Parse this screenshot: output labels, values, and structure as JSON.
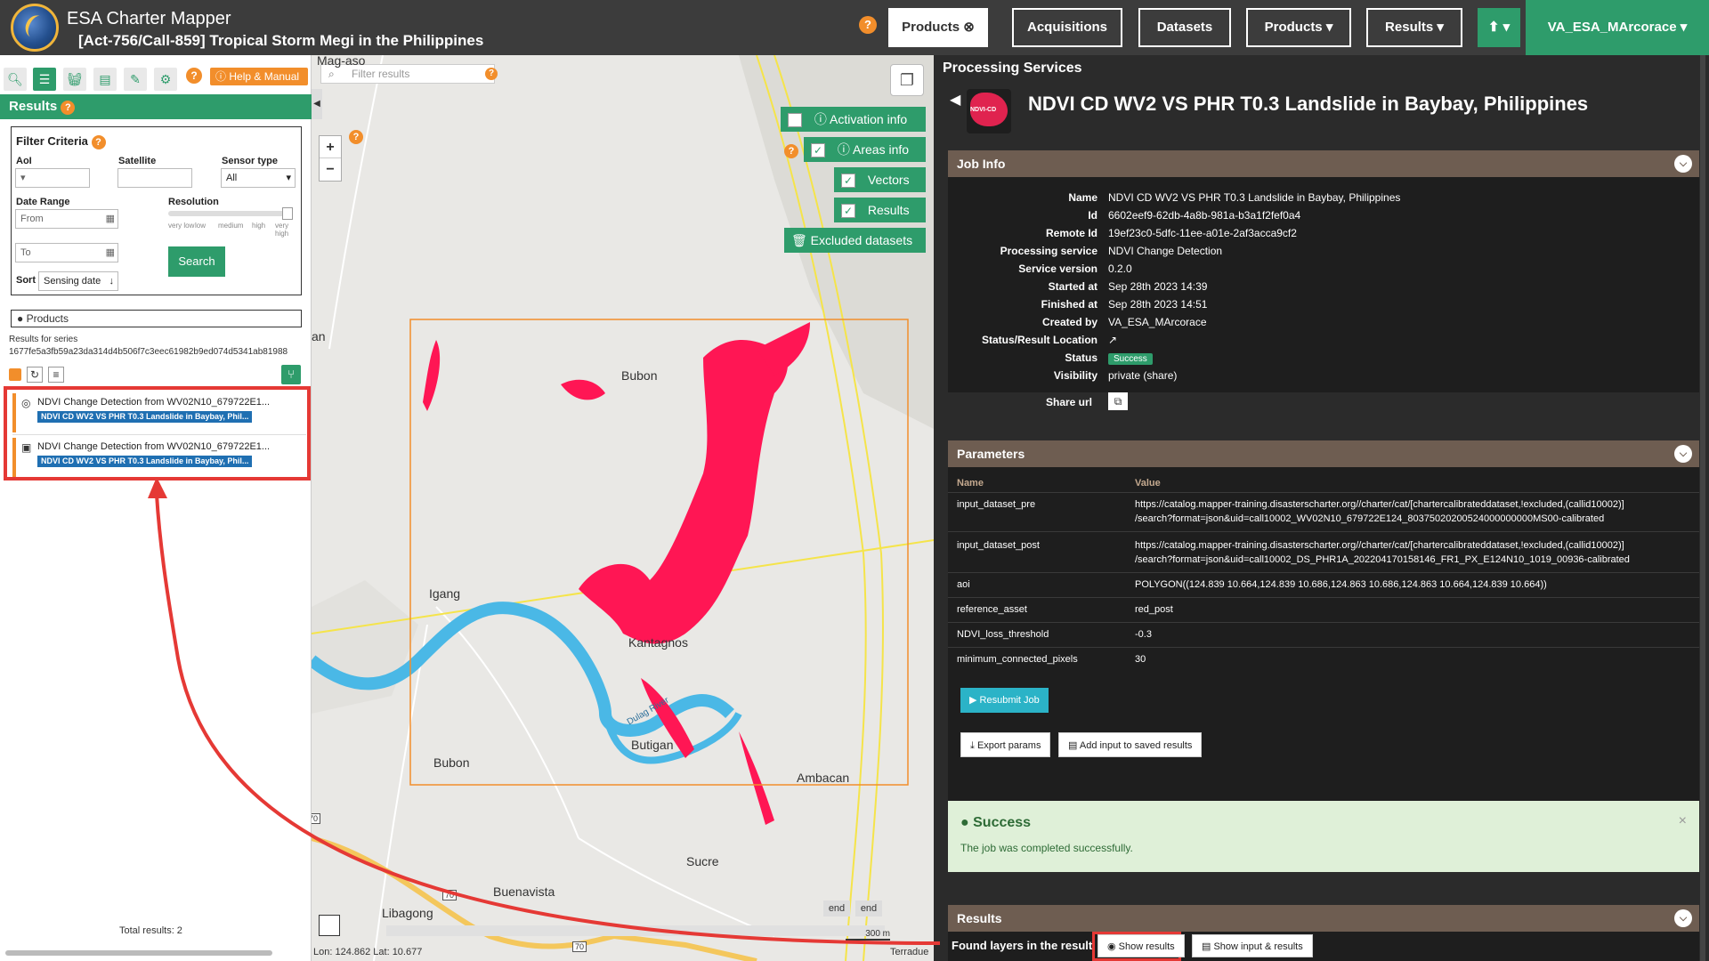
{
  "header": {
    "app_title": "ESA Charter Mapper",
    "subtitle": "[Act-756/Call-859] Tropical Storm Megi in the Philippines",
    "help_icon": "?",
    "nav": [
      {
        "label": "Products",
        "active": true,
        "icon": "close-circle-icon"
      },
      {
        "label": "Acquisitions"
      },
      {
        "label": "Datasets"
      },
      {
        "label": "Products ▾"
      },
      {
        "label": "Results ▾"
      }
    ],
    "upload_label": "⬆ ▾",
    "user": "VA_ESA_MArcorace ▾"
  },
  "left": {
    "help_manual": "Help & Manual",
    "results_title": "Results",
    "filter": {
      "title": "Filter Criteria",
      "aoi_label": "AoI",
      "satellite_label": "Satellite",
      "sensor_label": "Sensor type",
      "sensor_value": "All",
      "date_range_label": "Date Range",
      "from_placeholder": "From",
      "to_placeholder": "To",
      "resolution_label": "Resolution",
      "resolution_ticks": [
        "very low",
        "low",
        "medium",
        "high",
        "very high"
      ],
      "search_label": "Search",
      "sort_label": "Sort",
      "sort_value": "Sensing date"
    },
    "products_header": "Products",
    "series_label": "Results for series",
    "series_id": "1677fe5a3fb59a23da314d4b506f7c3eec61982b9ed074d5341ab81988",
    "items": [
      {
        "title": "NDVI Change Detection from WV02N10_679722E1...",
        "tag": "NDVI CD WV2 VS PHR T0.3 Landslide in Baybay, Phil...",
        "icon": "globe-icon"
      },
      {
        "title": "NDVI Change Detection from WV02N10_679722E1...",
        "tag": "NDVI CD WV2 VS PHR T0.3 Landslide in Baybay, Phil...",
        "icon": "image-icon"
      }
    ],
    "total_results": "Total results: 2"
  },
  "map": {
    "filter_placeholder": "Filter results",
    "zoom_in": "+",
    "zoom_out": "−",
    "overlays": [
      {
        "label": "Activation info",
        "checked": false
      },
      {
        "label": "Areas info",
        "checked": true
      },
      {
        "label": "Vectors",
        "checked": true
      },
      {
        "label": "Results",
        "checked": true
      },
      {
        "label": "Excluded datasets",
        "checked": null
      }
    ],
    "places": [
      "Mag-aso",
      "Bubon",
      "Igang",
      "Kantagnos",
      "Butigan",
      "Bubon",
      "Ambacan",
      "Sucre",
      "Libagong",
      "Buenavista",
      "an"
    ],
    "river_label": "Dulag River",
    "road_badges": [
      "70",
      "70",
      "70"
    ],
    "coordinates": "Lon: 124.862 Lat: 10.677",
    "scale": "300 m",
    "end_labels": [
      "end",
      "end"
    ],
    "attribution": "Terradue"
  },
  "panel": {
    "title": "Processing Services",
    "job_title": "NDVI CD WV2 VS PHR T0.3 Landslide in Baybay, Philippines",
    "icon_text": "NDVI-CD",
    "job_info": {
      "header": "Job Info",
      "rows": [
        {
          "k": "Name",
          "v": "NDVI CD WV2 VS PHR T0.3 Landslide in Baybay, Philippines"
        },
        {
          "k": "Id",
          "v": "6602eef9-62db-4a8b-981a-b3a1f2fef0a4"
        },
        {
          "k": "Remote Id",
          "v": "19ef23c0-5dfc-11ee-a01e-2af3acca9cf2"
        },
        {
          "k": "Processing service",
          "v": "NDVI Change Detection"
        },
        {
          "k": "Service version",
          "v": "0.2.0"
        },
        {
          "k": "Started at",
          "v": "Sep 28th 2023 14:39"
        },
        {
          "k": "Finished at",
          "v": "Sep 28th 2023 14:51"
        },
        {
          "k": "Created by",
          "v": "VA_ESA_MArcorace"
        },
        {
          "k": "Status/Result Location",
          "v": "↗"
        },
        {
          "k": "Status",
          "v": "Success"
        },
        {
          "k": "Visibility",
          "v": "private (share)"
        },
        {
          "k": "Share url",
          "v": "⧉"
        }
      ]
    },
    "parameters": {
      "header": "Parameters",
      "name_col": "Name",
      "value_col": "Value",
      "rows": [
        {
          "k": "input_dataset_pre",
          "v1": "https://catalog.mapper-training.disasterscharter.org//charter/cat/[chartercalibrateddataset,!excluded,(callid10002)]",
          "v2": "/search?format=json&uid=call10002_WV02N10_679722E124_80375020200524000000000MS00-calibrated"
        },
        {
          "k": "input_dataset_post",
          "v1": "https://catalog.mapper-training.disasterscharter.org//charter/cat/[chartercalibrateddataset,!excluded,(callid10002)]",
          "v2": "/search?format=json&uid=call10002_DS_PHR1A_202204170158146_FR1_PX_E124N10_1019_00936-calibrated"
        },
        {
          "k": "aoi",
          "v1": "POLYGON((124.839 10.664,124.839 10.686,124.863 10.686,124.863 10.664,124.839 10.664))",
          "v2": ""
        },
        {
          "k": "reference_asset",
          "v1": "red_post",
          "v2": ""
        },
        {
          "k": "NDVI_loss_threshold",
          "v1": "-0.3",
          "v2": ""
        },
        {
          "k": "minimum_connected_pixels",
          "v1": "30",
          "v2": ""
        }
      ],
      "resubmit": "Resubmit Job",
      "export": "Export params",
      "add_input": "Add input to saved results"
    },
    "success": {
      "title": "Success",
      "message": "The job was completed successfully.",
      "close": "×"
    },
    "results": {
      "header": "Results",
      "found": "Found layers in the result.",
      "show": "Show results",
      "show_input": "Show input & results"
    }
  },
  "colors": {
    "brand_green": "#2e9c6b",
    "accent_orange": "#f28e2b",
    "highlight_red": "#e53935",
    "change_pink": "#ff1654",
    "river_blue": "#4ab8e6"
  }
}
